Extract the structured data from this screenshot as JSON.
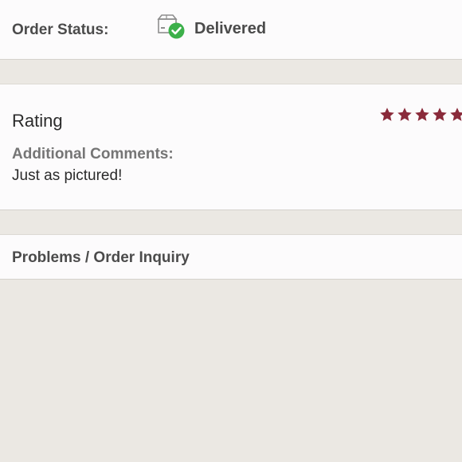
{
  "order_status": {
    "label": "Order Status:",
    "value": "Delivered",
    "icon": "delivered-box-check-icon",
    "check_color": "#3cb04a"
  },
  "rating": {
    "title": "Rating",
    "stars": 5,
    "star_color": "#8a2a3a",
    "comments_label": "Additional Comments:",
    "comments_text": "Just as pictured!"
  },
  "inquiry": {
    "label": "Problems / Order Inquiry"
  }
}
